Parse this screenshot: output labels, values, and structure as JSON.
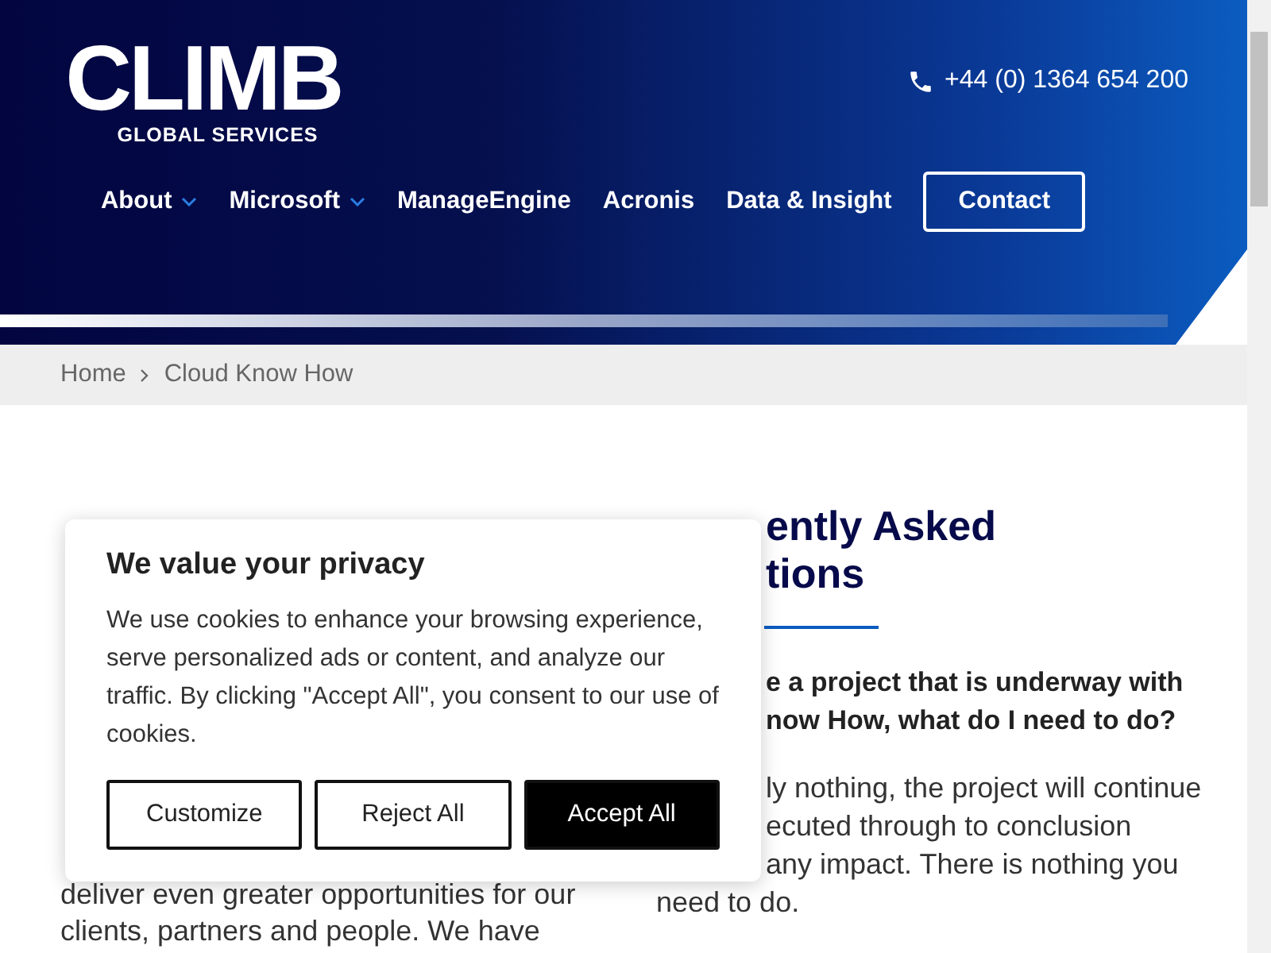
{
  "header": {
    "logo": {
      "wordmark": "CLIMB",
      "tagline": "GLOBAL SERVICES"
    },
    "phone": "+44 (0) 1364 654 200",
    "nav": [
      {
        "label": "About",
        "kind": "dropdown"
      },
      {
        "label": "Microsoft",
        "kind": "dropdown"
      },
      {
        "label": "ManageEngine",
        "kind": "link"
      },
      {
        "label": "Acronis",
        "kind": "link"
      },
      {
        "label": "Data & Insight",
        "kind": "link"
      },
      {
        "label": "Contact",
        "kind": "button"
      }
    ]
  },
  "breadcrumb": [
    "Home",
    "Cloud Know How"
  ],
  "left_column": {
    "paragraph_lines": [
      "deliver even greater opportunities for our",
      "clients, partners and people. We have"
    ]
  },
  "right_column": {
    "heading_lines": [
      "ently Asked",
      "tions"
    ],
    "question_lines": [
      "e a project that is underway with",
      "now How, what do I need to do?"
    ],
    "answer_lines": [
      "ly nothing, the project will continue",
      "ecuted through to conclusion",
      "any impact. There is nothing you",
      "need to do."
    ]
  },
  "cookie_banner": {
    "title": "We value your privacy",
    "text": "We use cookies to enhance your browsing experience, serve personalized ads or content, and analyze our traffic. By clicking \"Accept All\", you consent to our use of cookies.",
    "buttons": [
      {
        "label": "Customize",
        "kind": "outline"
      },
      {
        "label": "Reject All",
        "kind": "outline"
      },
      {
        "label": "Accept All",
        "kind": "filled"
      }
    ]
  }
}
